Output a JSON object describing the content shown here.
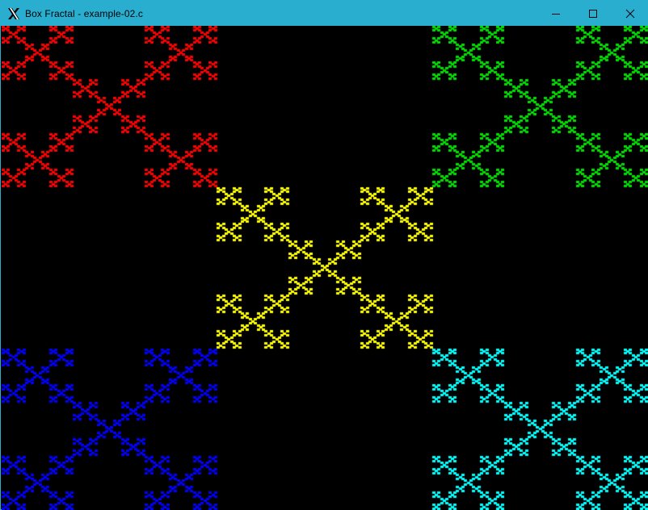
{
  "window": {
    "title": "Box Fractal - example-02.c",
    "icon": "x-window-icon",
    "controls": [
      "minimize-icon",
      "maximize-icon",
      "close-icon"
    ]
  },
  "canvas": {
    "background": "#000000",
    "fractal_type": "box (Vicsek cross) fractal",
    "colors": {
      "top_left": "#ff0000",
      "top_right": "#00e000",
      "center": "#ffff00",
      "bottom_left": "#0000ff",
      "bottom_right": "#00ffff"
    }
  }
}
